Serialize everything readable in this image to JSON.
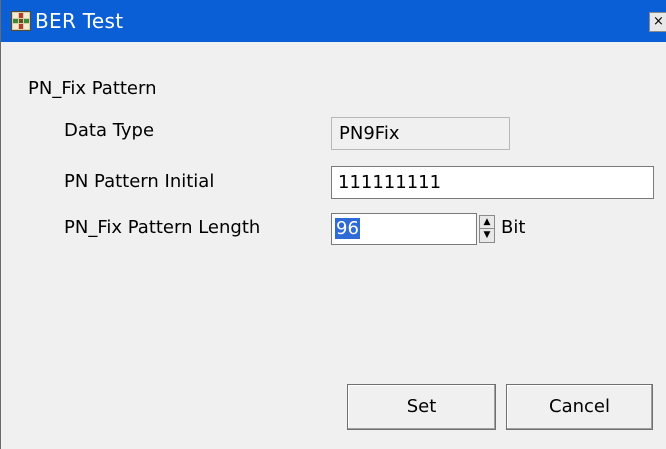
{
  "window": {
    "title": "BER Test",
    "icon": "ber-test-app-icon",
    "close_glyph": "×"
  },
  "form": {
    "section_title": "PN_Fix Pattern",
    "data_type": {
      "label": "Data Type",
      "value": "PN9Fix"
    },
    "pn_pattern_initial": {
      "label": "PN Pattern Initial",
      "value": "111111111"
    },
    "pn_fix_pattern_length": {
      "label": "PN_Fix Pattern Length",
      "value": "96",
      "unit": "Bit",
      "selected": true
    }
  },
  "buttons": {
    "set_label": "Set",
    "cancel_label": "Cancel"
  },
  "colors": {
    "titlebar": "#0b5fd6",
    "selection": "#2e6bd6",
    "window_bg": "#f0f0f0"
  }
}
